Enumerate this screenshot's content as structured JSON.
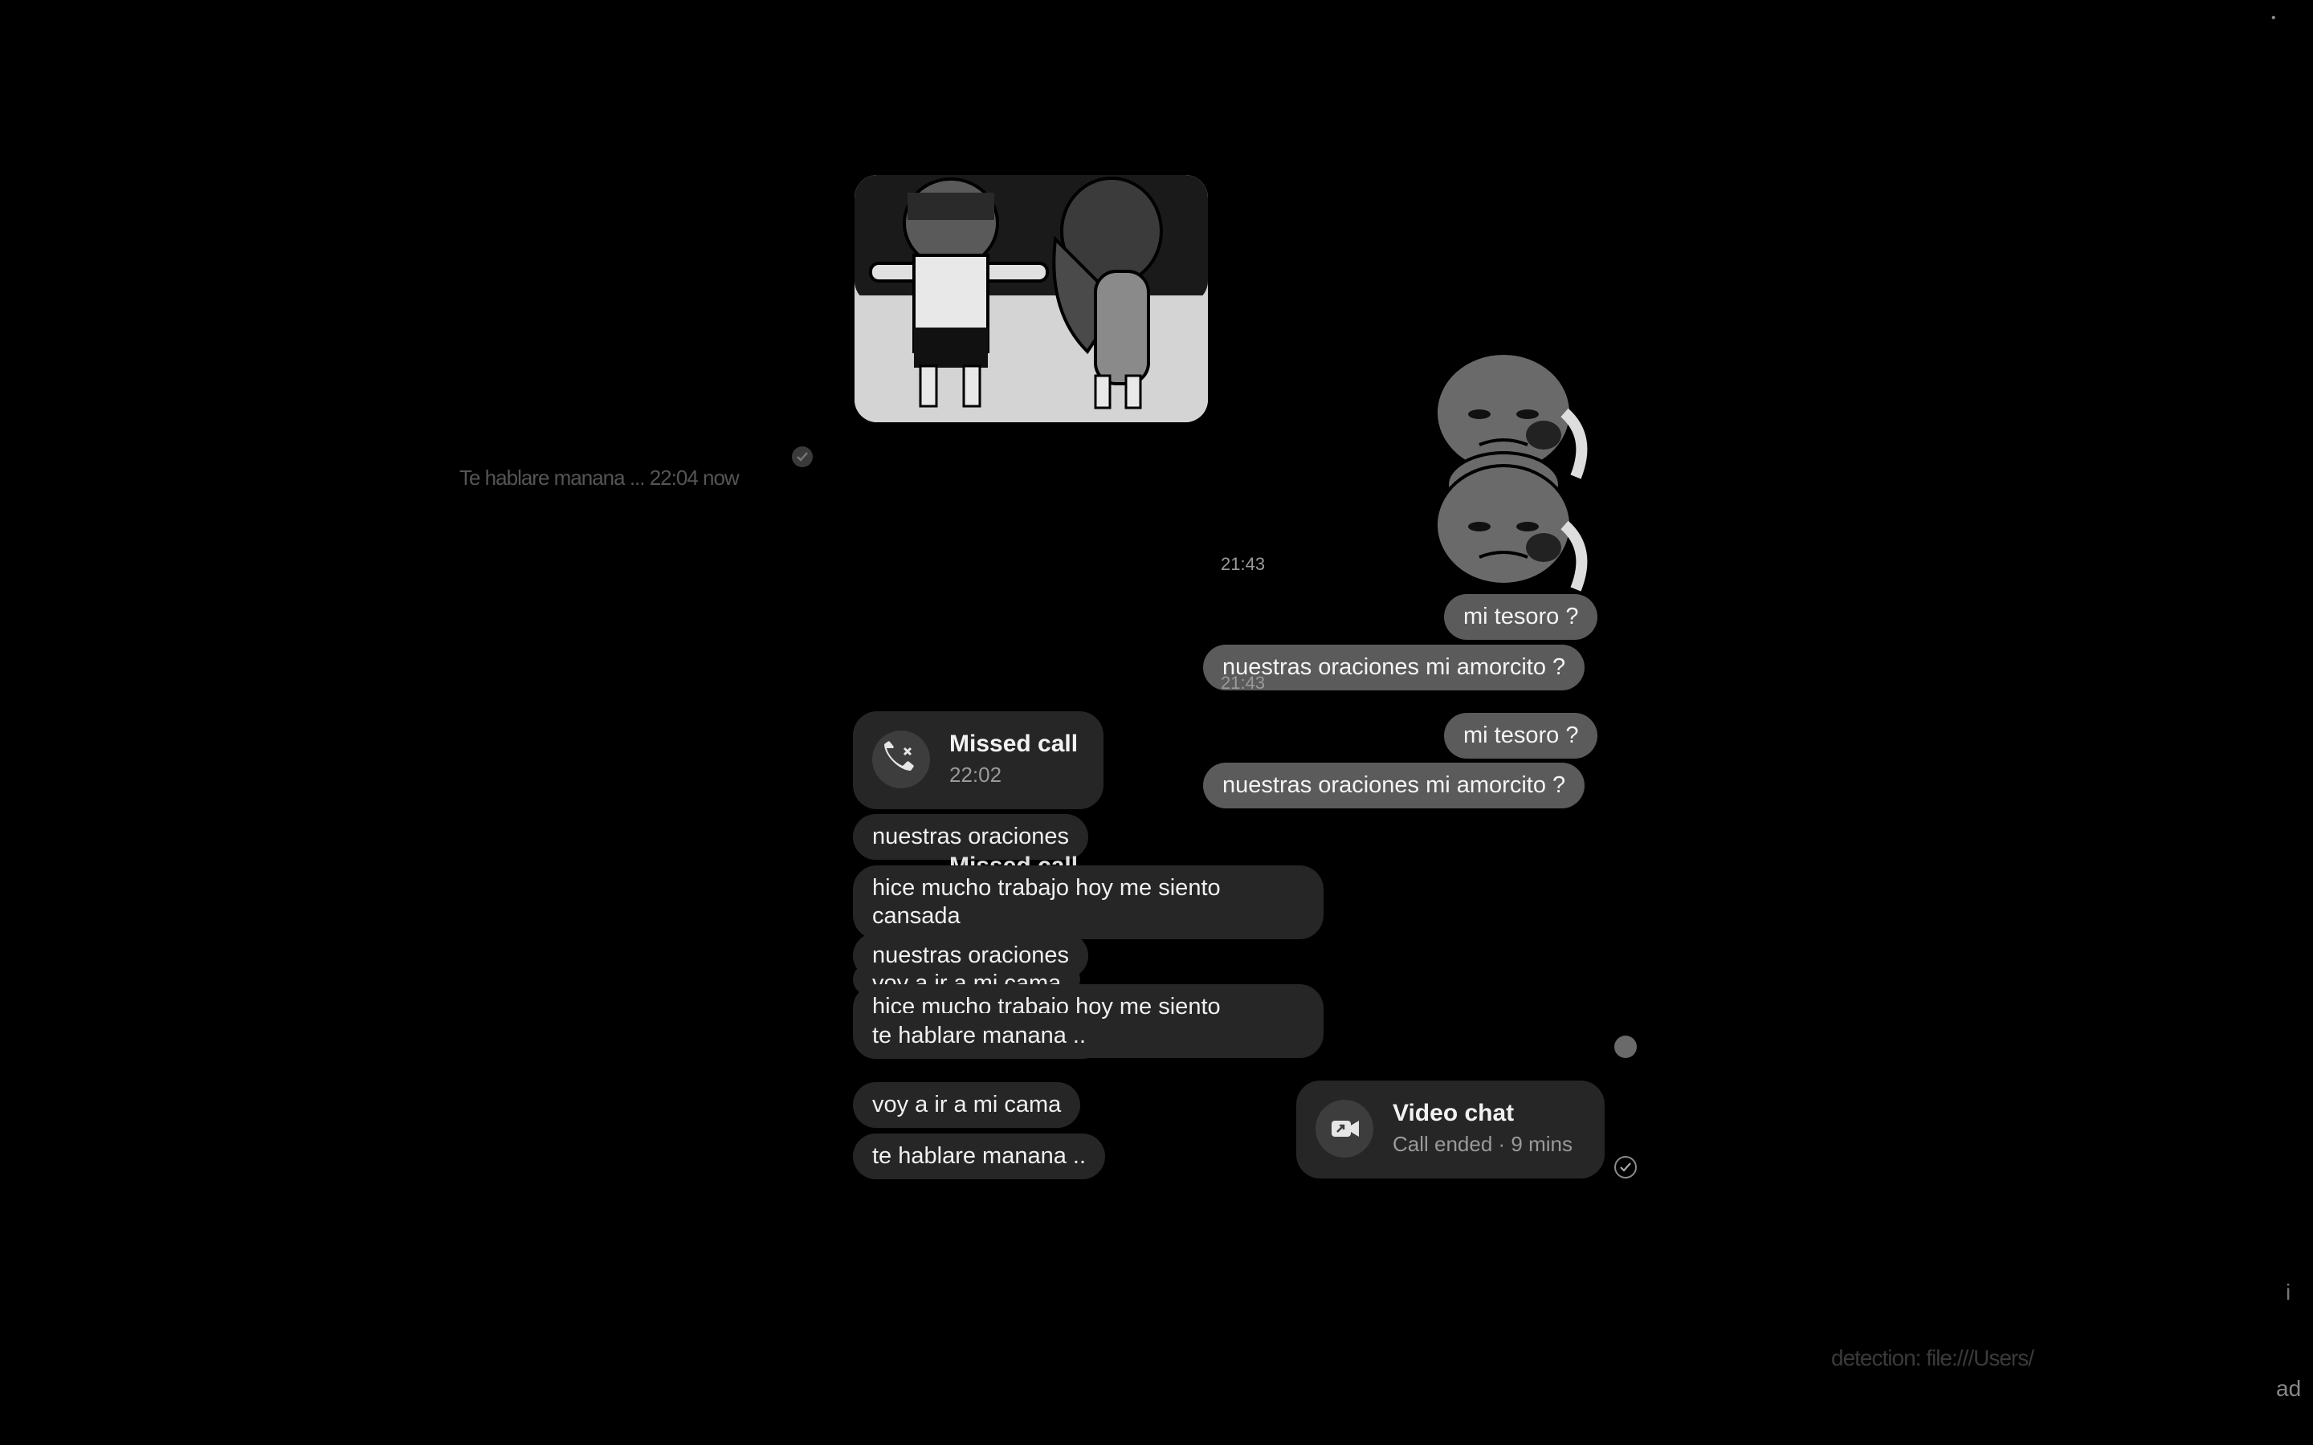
{
  "corner_top_right_glyph": "•",
  "left_ghost_text": "Te hablare manana ... 22:04 now",
  "timestamps": {
    "t1": "21:43",
    "t2": "21:43"
  },
  "outgoing": [
    {
      "text": "mi tesoro ?"
    },
    {
      "text": "nuestras oraciones mi amorcito ?"
    },
    {
      "text": "mi tesoro ?"
    },
    {
      "text": "nuestras oraciones mi amorcito ?"
    }
  ],
  "missed_call": {
    "title": "Missed call",
    "time": "22:02"
  },
  "missed_call_ghost": {
    "title": "Missed call",
    "time": "22:02"
  },
  "incoming": [
    {
      "text": "nuestras oraciones"
    },
    {
      "text": "hice mucho trabajo hoy me siento cansada"
    },
    {
      "text": "nuestras oraciones"
    },
    {
      "text": "voy a ir a mi cama"
    },
    {
      "text": "hice mucho trabajo hoy me siento cansada"
    },
    {
      "text": "te hablare manana .."
    },
    {
      "text": "voy a ir a mi cama"
    },
    {
      "text": "te hablare manana .."
    }
  ],
  "video_chat": {
    "title": "Video chat",
    "subtitle": "Call ended · 9 mins"
  },
  "bottom_right_ghost": "detection: file:///Users/",
  "bottom_right_edge": "ad",
  "right_edge_glyph": "i",
  "colors": {
    "background": "#000000",
    "incoming_bubble": "#262626",
    "outgoing_bubble": "#5b5b5b"
  }
}
